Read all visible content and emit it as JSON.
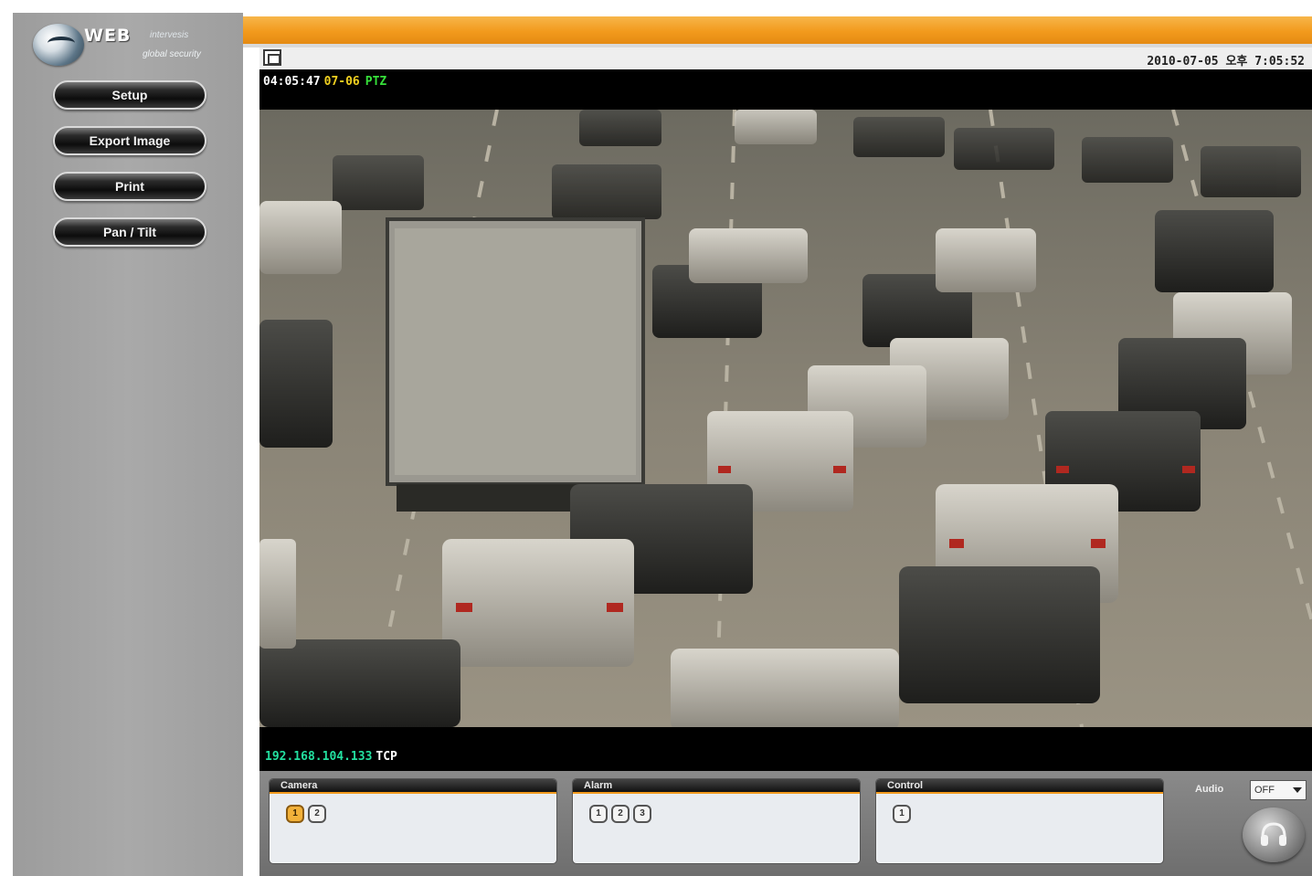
{
  "logo": {
    "brand": "WEB",
    "brand_sup": "intervesis",
    "tagline": "global security"
  },
  "sidebar": {
    "buttons": [
      {
        "label": "Setup"
      },
      {
        "label": "Export Image"
      },
      {
        "label": "Print"
      },
      {
        "label": "Pan / Tilt"
      }
    ]
  },
  "video": {
    "datetime": "2010-07-05 오후 7:05:52",
    "osd_time": "04:05:47",
    "osd_date": "07-06",
    "osd_mode": "PTZ",
    "osd_ip": "192.168.104.133",
    "osd_protocol": "TCP"
  },
  "panels": {
    "camera": {
      "title": "Camera",
      "chips": [
        "1",
        "2"
      ],
      "active": "1"
    },
    "alarm": {
      "title": "Alarm",
      "chips": [
        "1",
        "2",
        "3"
      ]
    },
    "control": {
      "title": "Control",
      "chips": [
        "1"
      ]
    }
  },
  "audio": {
    "label": "Audio",
    "value": "OFF"
  },
  "colors": {
    "accent": "#f29a1d",
    "sidebar": "#a5a5a5",
    "osd_date": "#f0d020",
    "osd_ptz": "#36e03a",
    "osd_ip": "#23e0a0"
  },
  "icons": {
    "fullscreen": "fullscreen-icon",
    "headphone": "headphone-icon",
    "globe": "globe-icon"
  }
}
